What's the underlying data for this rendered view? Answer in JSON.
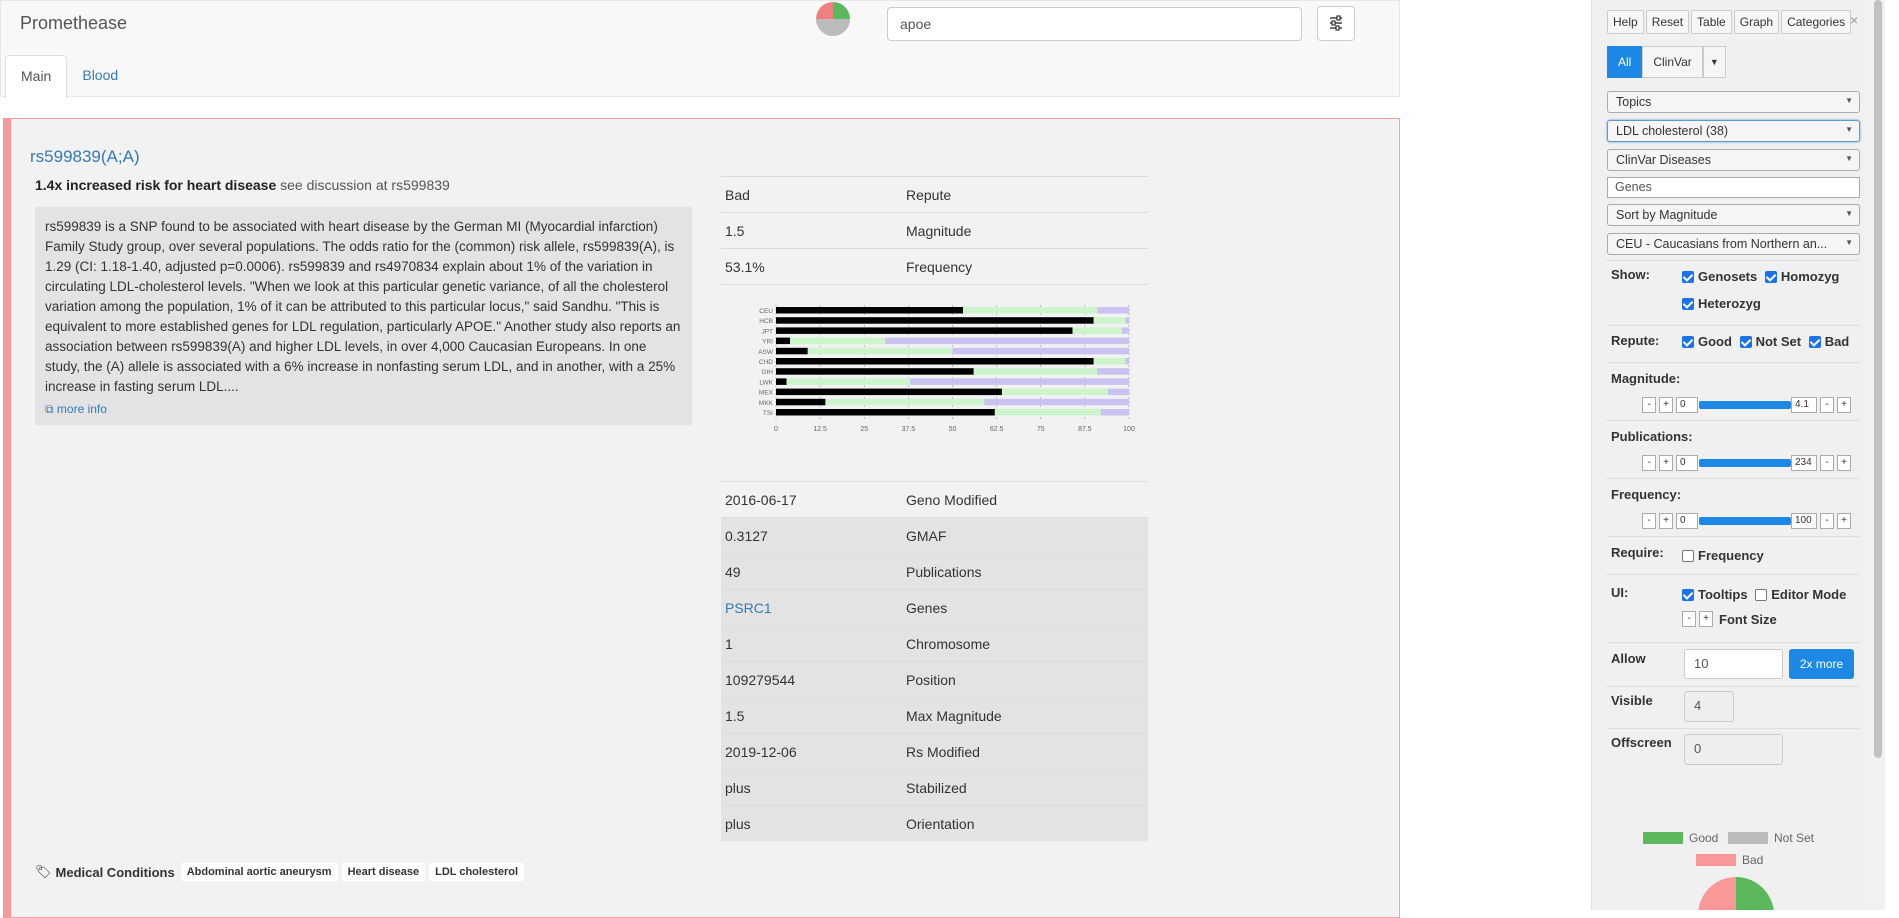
{
  "header": {
    "brand": "Promethease",
    "search_value": "apoe",
    "tabs": [
      "Main",
      "Blood"
    ]
  },
  "result": {
    "title": "rs599839(A;A)",
    "summary_bold": "1.4x increased risk for heart disease",
    "summary_rest": "see discussion at rs599839",
    "description": "rs599839 is a SNP found to be associated with heart disease by the German MI (Myocardial infarction) Family Study group, over several populations. The odds ratio for the (common) risk allele, rs599839(A), is 1.29 (CI: 1.18-1.40, adjusted p=0.0006). rs599839 and rs4970834 explain about 1% of the variation in circulating LDL-cholesterol levels. \"When we look at this particular genetic variance, of all the cholesterol variation among the population, 1% of it can be attributed to this particular locus,\" said Sandhu. \"This is equivalent to more established genes for LDL regulation, particularly APOE.\" Another study also reports an association between rs599839(A) and higher LDL levels, in over 4,000 Caucasian Europeans. In one study, the (A) allele is associated with a 6% increase in nonfasting serum LDL, and in another, with a 25% increase in fasting serum LDL....",
    "more_info": "more info",
    "top_rows": [
      {
        "value": "Bad",
        "key": "Repute"
      },
      {
        "value": "1.5",
        "key": "Magnitude"
      },
      {
        "value": "53.1%",
        "key": "Frequency"
      }
    ],
    "bottom_rows": [
      {
        "value": "2016-06-17",
        "key": "Geno Modified"
      },
      {
        "value": "0.3127",
        "key": "GMAF"
      },
      {
        "value": "49",
        "key": "Publications"
      },
      {
        "value": "PSRC1",
        "key": "Genes"
      },
      {
        "value": "1",
        "key": "Chromosome"
      },
      {
        "value": "109279544",
        "key": "Position"
      },
      {
        "value": "1.5",
        "key": "Max Magnitude"
      },
      {
        "value": "2019-12-06",
        "key": "Rs Modified"
      },
      {
        "value": "plus",
        "key": "Stabilized"
      },
      {
        "value": "plus",
        "key": "Orientation"
      }
    ],
    "medical_conditions_label": "Medical Conditions",
    "medical_conditions": [
      "Abdominal aortic aneurysm",
      "Heart disease",
      "LDL cholesterol"
    ]
  },
  "chart_data": {
    "type": "bar",
    "stacked": true,
    "categories": [
      "CEU",
      "HCB",
      "JPT",
      "YRI",
      "ASW",
      "CHD",
      "GIH",
      "LWK",
      "MEX",
      "MKK",
      "TSI"
    ],
    "series": [
      {
        "values": [
          53,
          90,
          84,
          4,
          9,
          90,
          56,
          3,
          64,
          14,
          62
        ]
      },
      {
        "values": [
          38,
          9,
          14,
          27,
          41,
          9,
          35,
          35,
          30,
          45,
          30
        ]
      },
      {
        "values": [
          9,
          1,
          2,
          69,
          50,
          1,
          9,
          62,
          6,
          41,
          8
        ]
      }
    ],
    "colors": [
      "#000000",
      "#ccf5cc",
      "#c8c3f0"
    ],
    "x_ticks": [
      "0",
      "12.5",
      "25",
      "37.5",
      "50",
      "62.5",
      "75",
      "87.5",
      "100"
    ],
    "xlim": [
      0,
      100
    ],
    "grid": true
  },
  "sidebar": {
    "buttons": [
      "Help",
      "Reset",
      "Table",
      "Graph",
      "Categories"
    ],
    "close": "×",
    "source_buttons": [
      "All",
      "ClinVar"
    ],
    "dropdowns": [
      "Topics",
      "LDL cholesterol (38)",
      "ClinVar Diseases"
    ],
    "genes_value": "Genes",
    "sort_dropdown": "Sort by Magnitude",
    "population_dropdown": "CEU - Caucasians from Northern an...",
    "show_label": "Show:",
    "show_opts": [
      "Genosets",
      "Homozyg",
      "Heterozyg"
    ],
    "repute_label": "Repute:",
    "repute_opts": [
      "Good",
      "Not Set",
      "Bad"
    ],
    "magnitude_label": "Magnitude:",
    "magnitude_min": "0",
    "magnitude_max": "4.1",
    "publications_label": "Publications:",
    "publications_min": "0",
    "publications_max": "234",
    "frequency_label": "Frequency:",
    "frequency_min": "0",
    "frequency_max": "100",
    "require_label": "Require:",
    "require_opt": "Frequency",
    "ui_label": "UI:",
    "ui_tooltips": "Tooltips",
    "ui_editor": "Editor Mode",
    "font_size_label": "Font Size",
    "allow_label": "Allow",
    "allow_value": "10",
    "more_button": "2x more",
    "visible_label": "Visible",
    "visible_value": "4",
    "offscreen_label": "Offscreen",
    "offscreen_value": "0",
    "legend": {
      "good": "Good",
      "notset": "Not Set",
      "bad": "Bad"
    },
    "step_minus": "-",
    "step_plus": "+"
  }
}
